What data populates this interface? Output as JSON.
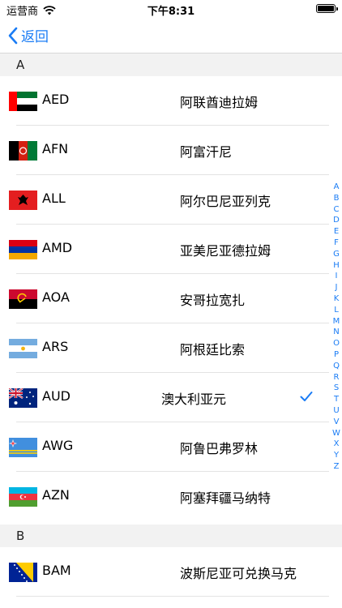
{
  "status_bar": {
    "carrier": "运营商",
    "time": "下午8:31"
  },
  "nav": {
    "back_label": "返回"
  },
  "sections": [
    {
      "letter": "A"
    },
    {
      "letter": "B"
    }
  ],
  "currencies": [
    {
      "code": "AED",
      "name": "阿联酋迪拉姆",
      "flag": "uae-flag-icon"
    },
    {
      "code": "AFN",
      "name": "阿富汗尼",
      "flag": "afghanistan-flag-icon"
    },
    {
      "code": "ALL",
      "name": "阿尔巴尼亚列克",
      "flag": "albania-flag-icon"
    },
    {
      "code": "AMD",
      "name": "亚美尼亚德拉姆",
      "flag": "armenia-flag-icon"
    },
    {
      "code": "AOA",
      "name": "安哥拉宽扎",
      "flag": "angola-flag-icon"
    },
    {
      "code": "ARS",
      "name": "阿根廷比索",
      "flag": "argentina-flag-icon"
    },
    {
      "code": "AUD",
      "name": "澳大利亚元",
      "flag": "australia-flag-icon",
      "selected": true
    },
    {
      "code": "AWG",
      "name": "阿鲁巴弗罗林",
      "flag": "aruba-flag-icon"
    },
    {
      "code": "AZN",
      "name": "阿塞拜疆马纳特",
      "flag": "azerbaijan-flag-icon"
    },
    {
      "code": "BAM",
      "name": "波斯尼亚可兑换马克",
      "flag": "bosnia-flag-icon"
    }
  ],
  "index_letters": [
    "A",
    "B",
    "C",
    "D",
    "E",
    "F",
    "G",
    "H",
    "I",
    "J",
    "K",
    "L",
    "M",
    "N",
    "O",
    "P",
    "Q",
    "R",
    "S",
    "T",
    "U",
    "V",
    "W",
    "X",
    "Y",
    "Z"
  ],
  "colors": {
    "accent": "#1a7cf5",
    "section_bg": "#f2f2f2"
  }
}
